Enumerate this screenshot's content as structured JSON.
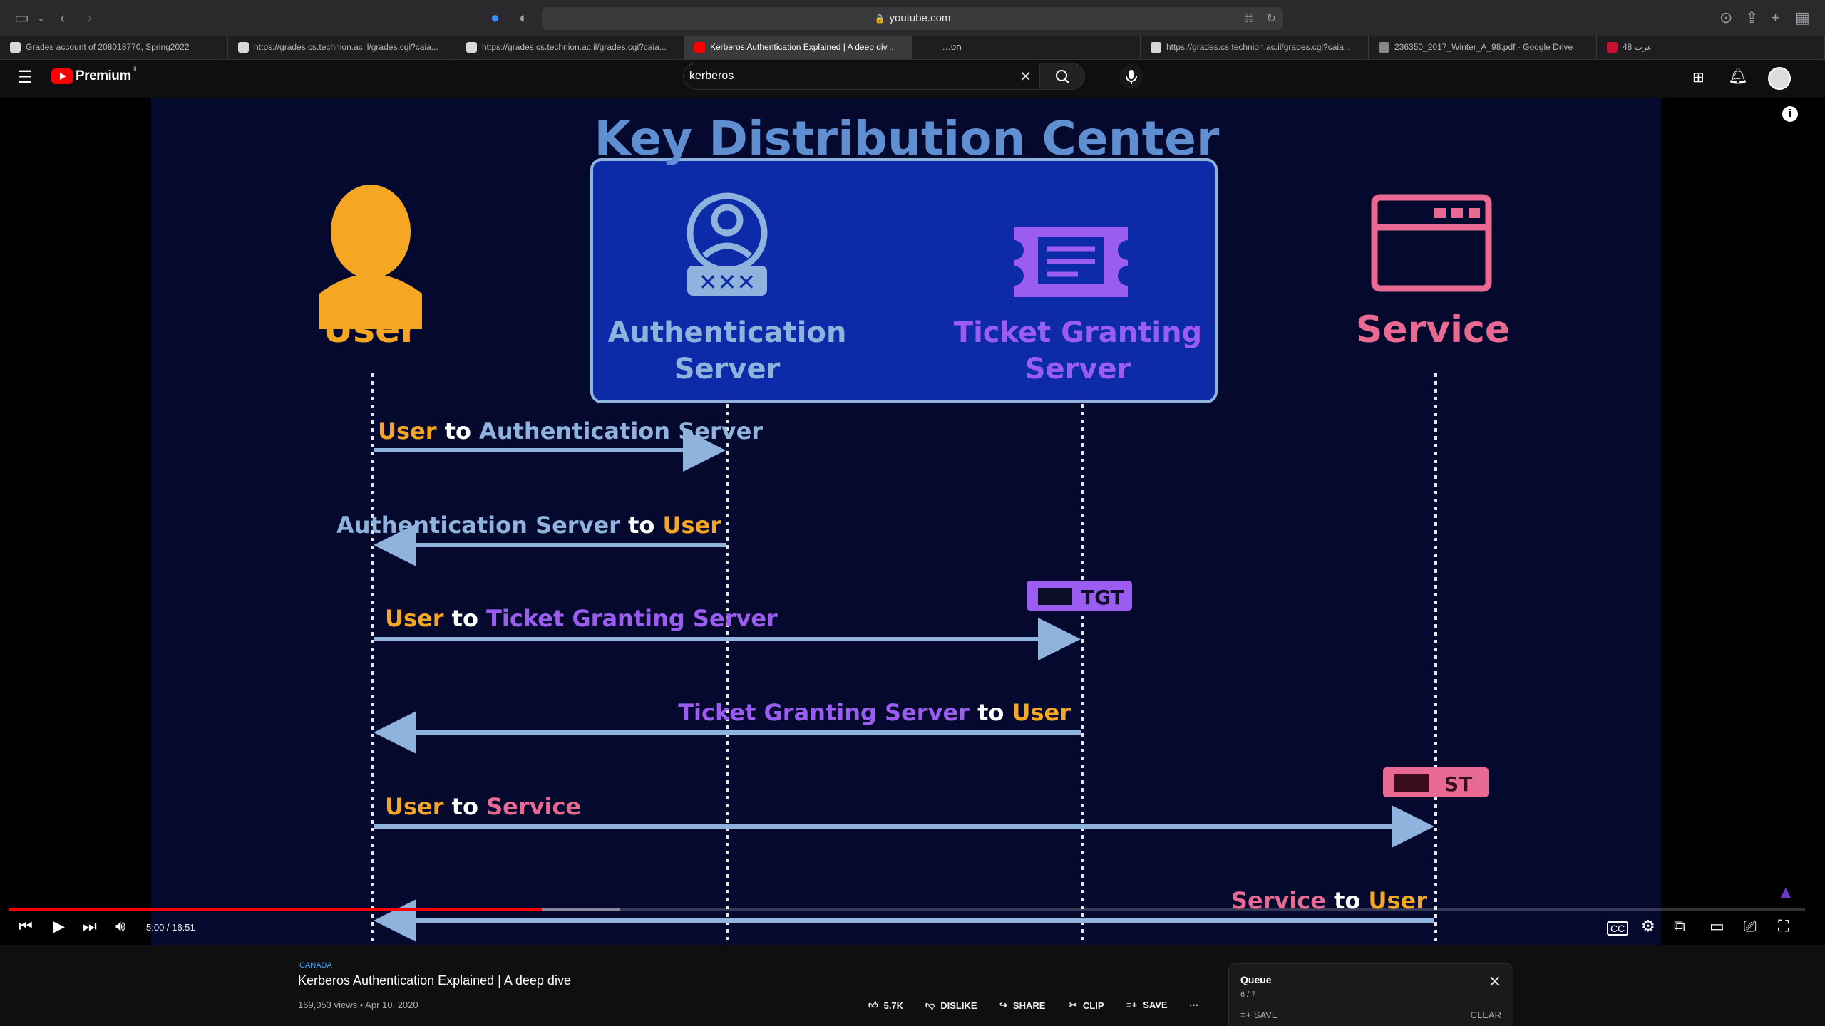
{
  "browser": {
    "url": "youtube.com",
    "tabs": [
      "Grades account of 208018770, Spring2022",
      "https://grades.cs.technion.ac.il/grades.cgi?caia...",
      "https://grades.cs.technion.ac.il/grades.cgi?caia...",
      "Kerberos Authentication Explained | A deep div...",
      "הטכניון - מאגר טריוויות",
      "https://grades.cs.technion.ac.il/grades.cgi?caia...",
      "236350_2017_Winter_A_98.pdf - Google Drive",
      "48 عرب"
    ],
    "active_tab_index": 3
  },
  "youtube": {
    "logo_text": "Premium",
    "country_code": "IL",
    "search_value": "kerberos"
  },
  "slide": {
    "title": "Key Distribution Center",
    "actors": {
      "user": "User",
      "auth": [
        "Authentication",
        "Server"
      ],
      "tgs": [
        "Ticket Granting",
        "Server"
      ],
      "service": "Service"
    },
    "badges": {
      "tgt": "TGT",
      "st": "ST"
    },
    "messages": [
      {
        "from": "User",
        "joiner": "to",
        "to": "Authentication Server"
      },
      {
        "from": "Authentication Server",
        "joiner": "to",
        "to": "User"
      },
      {
        "from": "User",
        "joiner": "to",
        "to": "Ticket Granting Server"
      },
      {
        "from": "Ticket Granting Server",
        "joiner": "to",
        "to": "User"
      },
      {
        "from": "User",
        "joiner": "to",
        "to": "Service"
      },
      {
        "from": "Service",
        "joiner": "to",
        "to": "User"
      }
    ],
    "colors": {
      "user": "#f5a623",
      "auth": "#8fb3dc",
      "tgs": "#9b5cf0",
      "service": "#e86a92",
      "kdc_box": "#0d2aa8",
      "background": "#05092e"
    }
  },
  "player": {
    "current_time": "5:00",
    "duration": "16:51",
    "time_display": "5:00 / 16:51",
    "played_fraction": 0.297,
    "buffered_fraction": 0.34
  },
  "video": {
    "location": "CANADA",
    "title": "Kerberos Authentication Explained | A deep dive",
    "views_date": "169,053 views • Apr 10, 2020",
    "likes": "5.7K",
    "dislike_label": "DISLIKE",
    "share_label": "SHARE",
    "clip_label": "CLIP",
    "save_label": "SAVE"
  },
  "queue": {
    "title": "Queue",
    "count": "6 / 7",
    "save_label": "SAVE",
    "clear_label": "CLEAR"
  }
}
